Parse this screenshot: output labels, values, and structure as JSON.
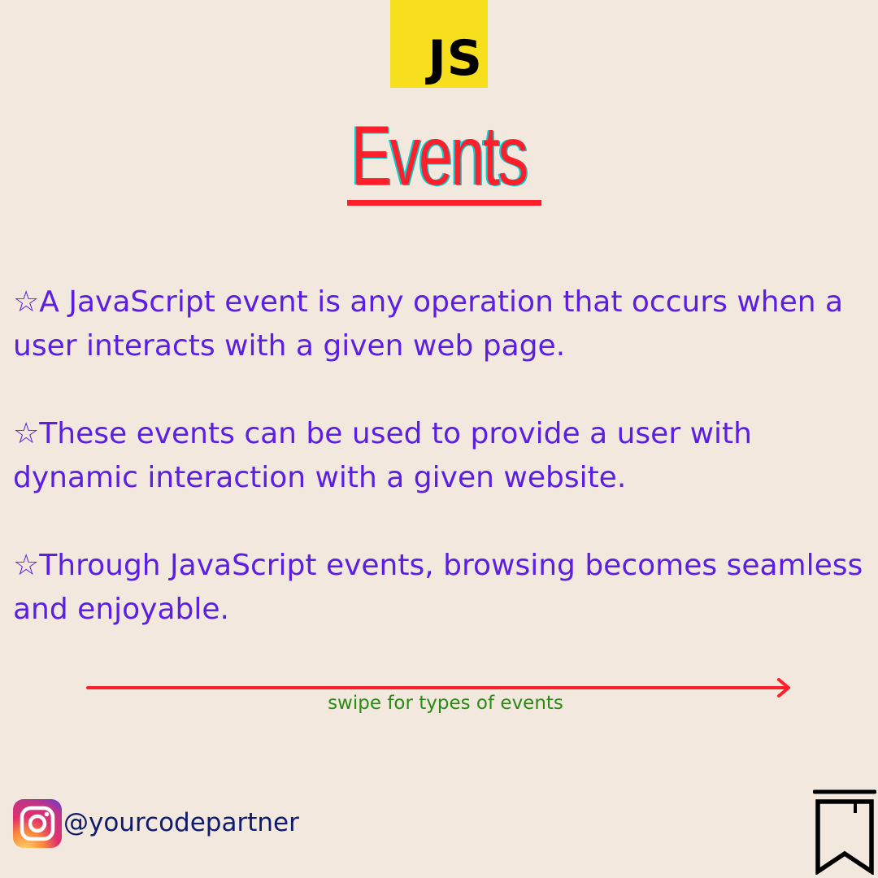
{
  "logo": {
    "text": "JS",
    "color": "#f7df1e"
  },
  "title": "Events",
  "points": [
    {
      "marker": "☆",
      "text": "A JavaScript event is any operation that occurs when a user interacts with a given web page."
    },
    {
      "marker": "☆",
      "text": "These events can be used to provide a user with dynamic interaction with a given website."
    },
    {
      "marker": "☆",
      "text": "Through JavaScript events, browsing becomes seamless and enjoyable."
    }
  ],
  "swipe": {
    "text": "swipe for types of events"
  },
  "footer": {
    "handle": "@yourcodepartner",
    "social_icon": "instagram-icon",
    "save_icon": "bookmark-icon"
  },
  "colors": {
    "background": "#f2e8de",
    "title": "#ff1f2b",
    "body_text": "#5b1fe3",
    "arrow": "#ff1f2b",
    "swipe_text": "#2a8a14",
    "handle": "#0e1a6b"
  }
}
